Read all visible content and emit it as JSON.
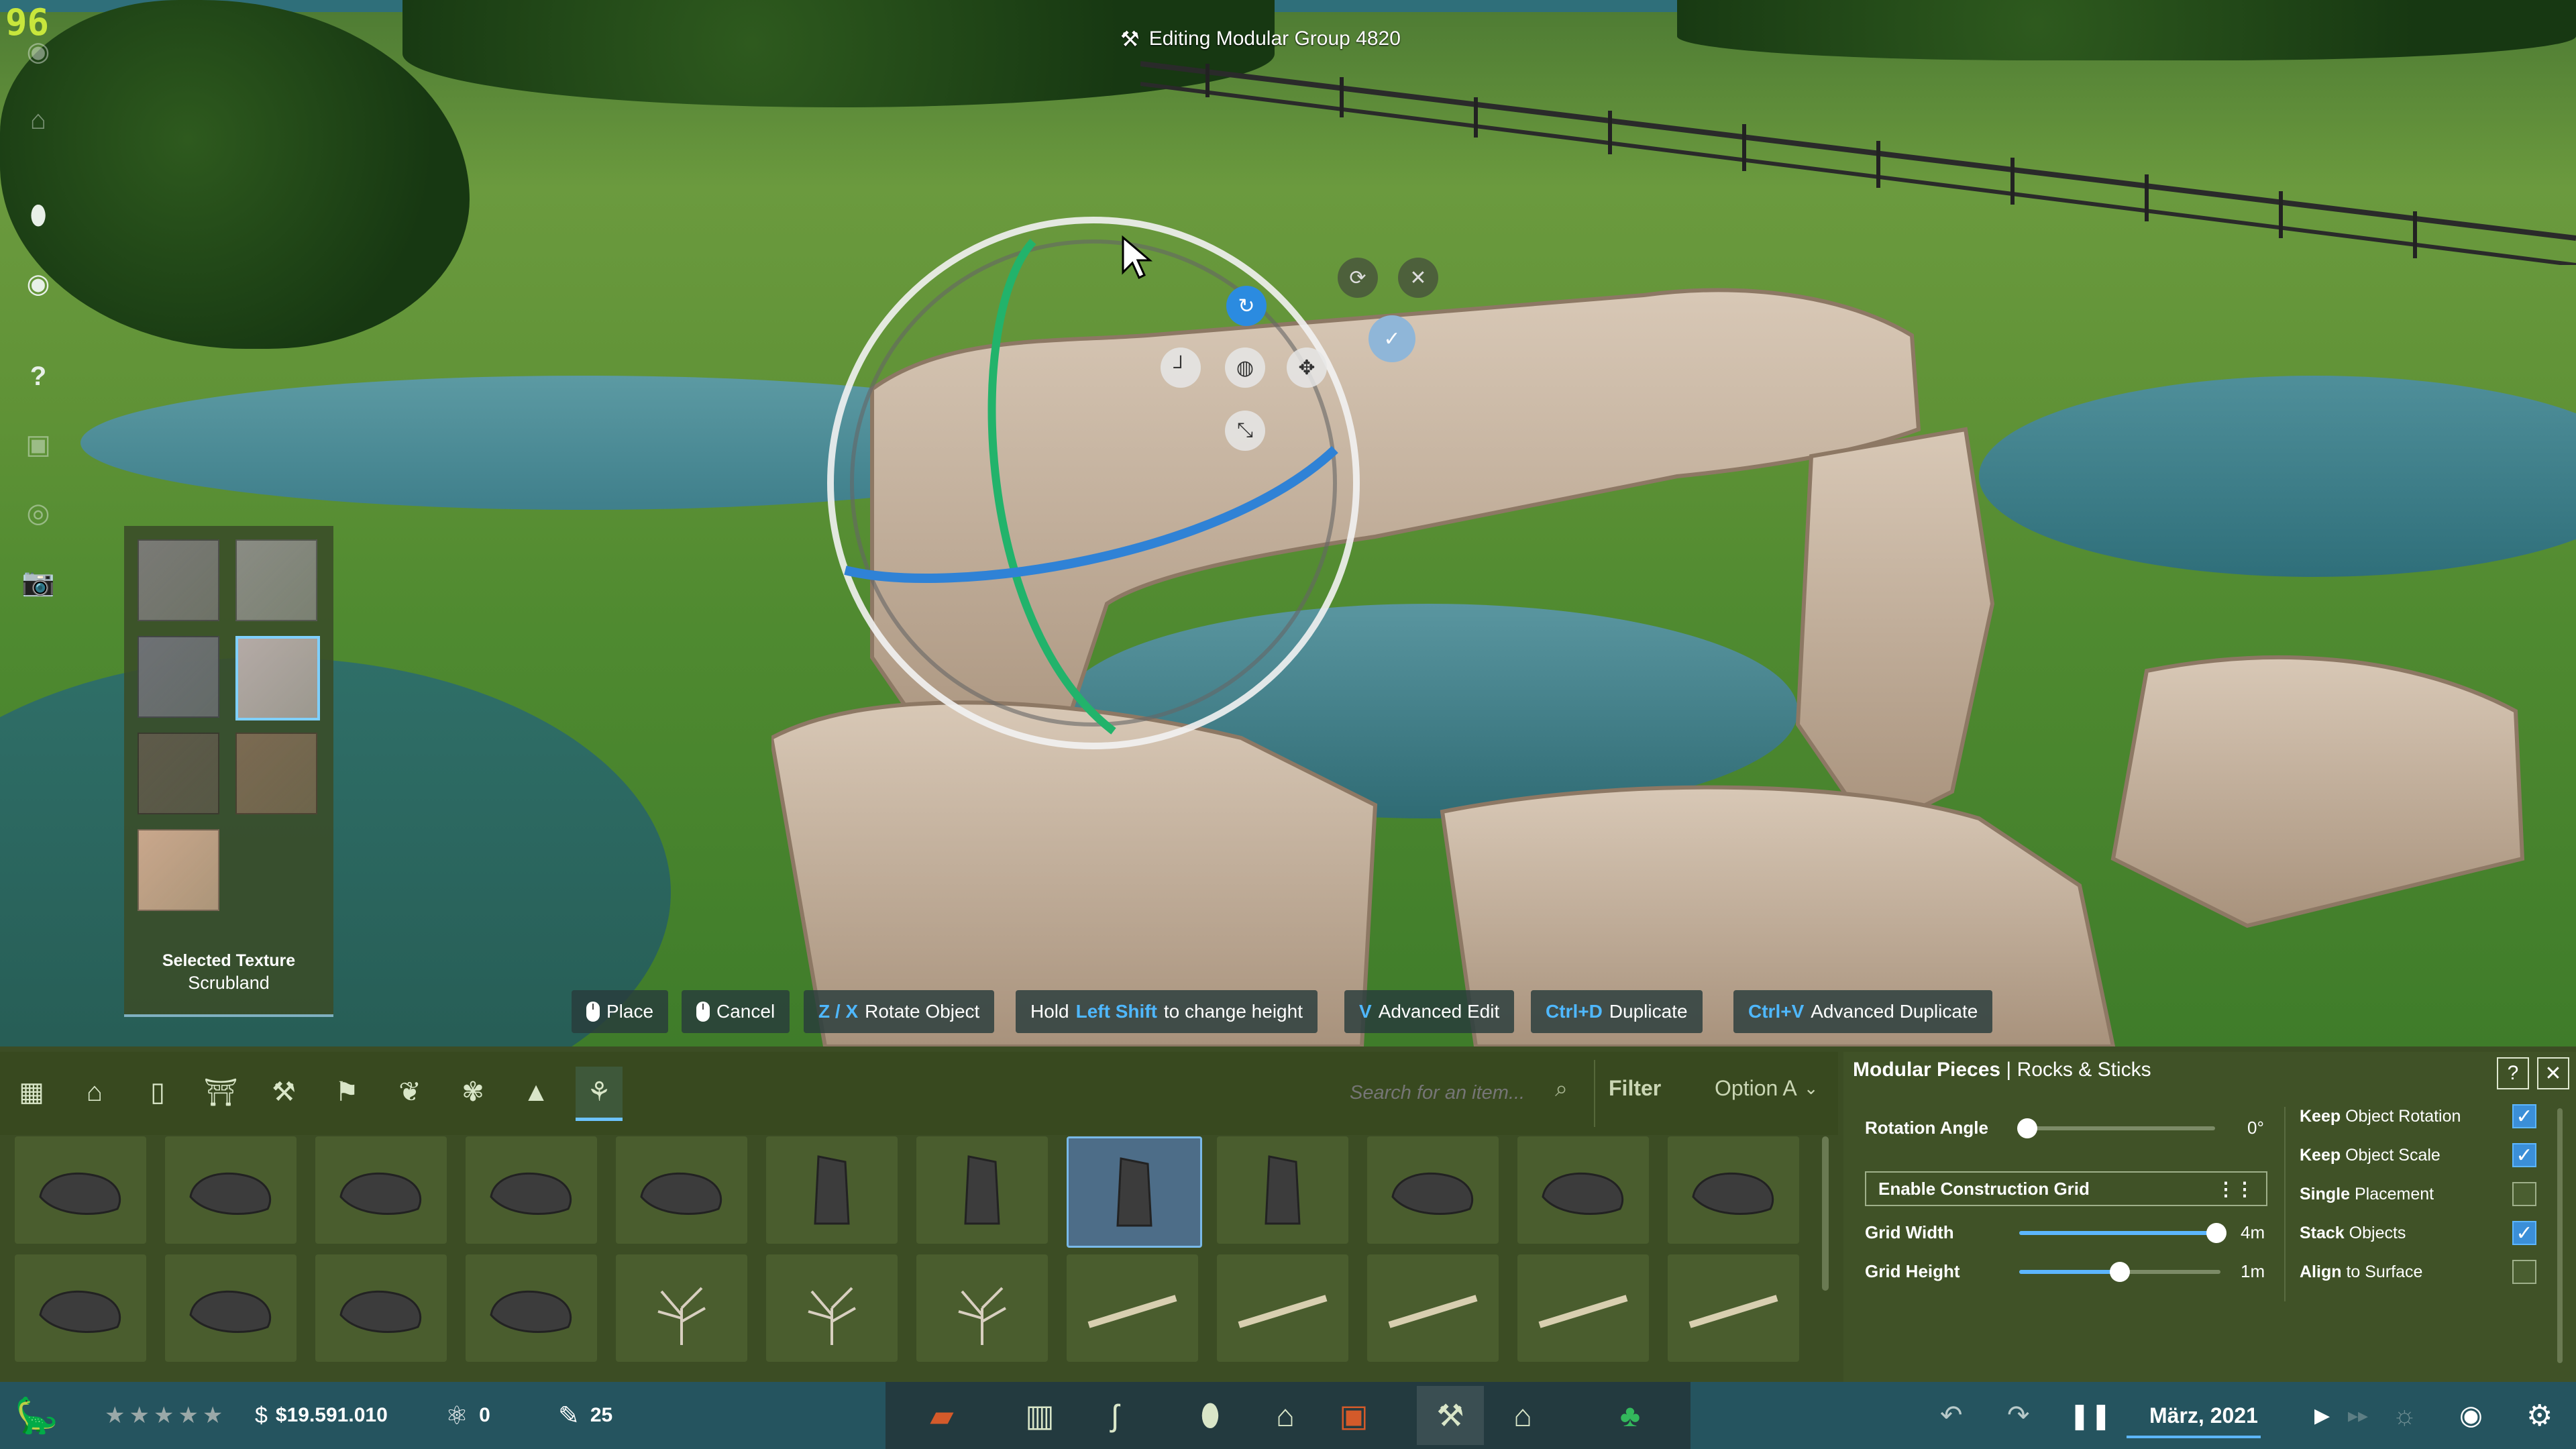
{
  "hud": {
    "fps": "96",
    "editing_title": "Editing Modular Group 4820"
  },
  "left_toolbar": {
    "icons": [
      "egg-icon",
      "eye-icon",
      "help-icon",
      "camera-icon"
    ],
    "help_glyph": "?"
  },
  "texture_panel": {
    "label": "Selected Texture",
    "value": "Scrubland",
    "swatches": [
      "#7a7a76",
      "#8a8c84",
      "#6e7175",
      "#b4aaa6",
      "#5e5a4a",
      "#7b6a52",
      "#c9a78c"
    ],
    "selected_index": 3
  },
  "hints": [
    {
      "key": "",
      "label": "Place",
      "mouse": true
    },
    {
      "key": "",
      "label": "Cancel",
      "mouse": true
    },
    {
      "key": "Z / X",
      "label": "Rotate Object",
      "mouse": false
    },
    {
      "pre": "Hold",
      "key": "Left Shift",
      "label": "to change height",
      "mouse": false
    },
    {
      "key": "V",
      "label": "Advanced Edit",
      "mouse": false
    },
    {
      "key": "Ctrl+D",
      "label": "Duplicate",
      "mouse": false
    },
    {
      "key": "Ctrl+V",
      "label": "Advanced Duplicate",
      "mouse": false
    }
  ],
  "gizmo": {
    "icons": [
      "rotate-arc-icon",
      "reset-icon",
      "close-icon",
      "confirm-check-icon",
      "snap-corner-icon",
      "globe-icon",
      "move-icon",
      "scale-icon"
    ]
  },
  "browser": {
    "search_placeholder": "Search for an item...",
    "filter_label": "Filter",
    "option_label": "Option A",
    "categories": [
      "grid-icon",
      "house-icon",
      "door-icon",
      "gate-icon",
      "crane-icon",
      "sign-icon",
      "plant-icon",
      "fern-icon",
      "tree-icon",
      "bush-icon"
    ],
    "active_category": 9,
    "selected_item": 7,
    "rows": 2,
    "items_per_row": 12
  },
  "modular": {
    "title": "Modular Pieces",
    "subtitle": "Rocks & Sticks",
    "help_glyph": "?",
    "close_glyph": "✕",
    "rotation_label": "Rotation Angle",
    "rotation_value": "0°",
    "rotation_fraction": 0.0,
    "grid_button": "Enable Construction Grid",
    "grid_width_label": "Grid Width",
    "grid_width_value": "4m",
    "grid_width_fraction": 0.98,
    "grid_height_label": "Grid Height",
    "grid_height_value": "1m",
    "grid_height_fraction": 0.5,
    "options": [
      {
        "b": "Keep",
        "rest": " Object Rotation",
        "checked": true
      },
      {
        "b": "Keep",
        "rest": " Object Scale",
        "checked": true
      },
      {
        "b": "Single",
        "rest": " Placement",
        "checked": false
      },
      {
        "b": "Stack",
        "rest": " Objects",
        "checked": true
      },
      {
        "b": "Align",
        "rest": " to Surface",
        "checked": false
      }
    ]
  },
  "status": {
    "rating_stars": 5,
    "money": "$19.591.010",
    "research": "0",
    "dinos": "25",
    "date": "März, 2021",
    "center_icons": [
      "hatchery-icon",
      "fence-icon",
      "dino-icon",
      "egg-icon",
      "building-icon",
      "shop-icon",
      "build-tools-icon",
      "shelter-icon",
      "tree-icon"
    ],
    "active_center": 6
  },
  "colors": {
    "accent": "#5cb6ff",
    "panel": "#3c4d24",
    "status": "#25545f",
    "fps": "#c8e63c"
  }
}
